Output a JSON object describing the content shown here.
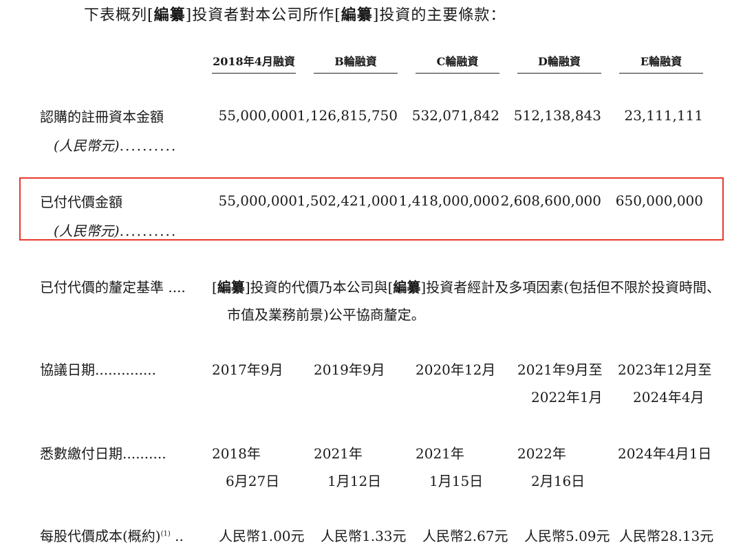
{
  "intro": {
    "p1": "下表概列[",
    "b1": "編纂",
    "p2": "]投資者對本公司所作[",
    "b2": "編纂",
    "p3": "]投資的主要條款："
  },
  "columns": [
    "2018年4月融資",
    "B輪融資",
    "C輪融資",
    "D輪融資",
    "E輪融資"
  ],
  "rows": {
    "subscribed": {
      "label": "認購的註冊資本金額",
      "sublabel": "(人民幣元)",
      "dots": "..........",
      "values": [
        "55,000,000",
        "1,126,815,750",
        "532,071,842",
        "512,138,843",
        "23,111,111"
      ]
    },
    "paid": {
      "label": "已付代價金額",
      "sublabel": "(人民幣元)",
      "dots": "..........",
      "values": [
        "55,000,000",
        "1,502,421,000",
        "1,418,000,000",
        "2,608,600,000",
        "650,000,000"
      ]
    },
    "basis": {
      "label": "已付代價的釐定基準 ....",
      "line1_a": "[",
      "line1_b": "編纂",
      "line1_c": "]投資的代價乃本公司與[",
      "line1_d": "編纂",
      "line1_e": "]投資者經計及多項因素(包括但不限於投資時間、",
      "line2": "市值及業務前景)公平協商釐定。"
    },
    "agreement": {
      "label": "協議日期..............",
      "values": [
        [
          "2017年9月"
        ],
        [
          "2019年9月"
        ],
        [
          "2020年12月"
        ],
        [
          "2021年9月至",
          "2022年1月"
        ],
        [
          "2023年12月至",
          "2024年4月"
        ]
      ]
    },
    "settlement": {
      "label": "悉數繳付日期..........",
      "values": [
        [
          "2018年",
          "6月27日"
        ],
        [
          "2021年",
          "1月12日"
        ],
        [
          "2021年",
          "1月15日"
        ],
        [
          "2022年",
          "2月16日"
        ],
        [
          "2024年4月1日"
        ]
      ]
    },
    "cost": {
      "label": "每股代價成本(概約)",
      "note": "(1)",
      "dots": " ..",
      "values": [
        "人民幣1.00元",
        "人民幣1.33元",
        "人民幣2.67元",
        "人民幣5.09元",
        "人民幣28.13元"
      ]
    }
  },
  "colors": {
    "highlight_border": "#e53b2c",
    "text": "#1a1a1a"
  }
}
